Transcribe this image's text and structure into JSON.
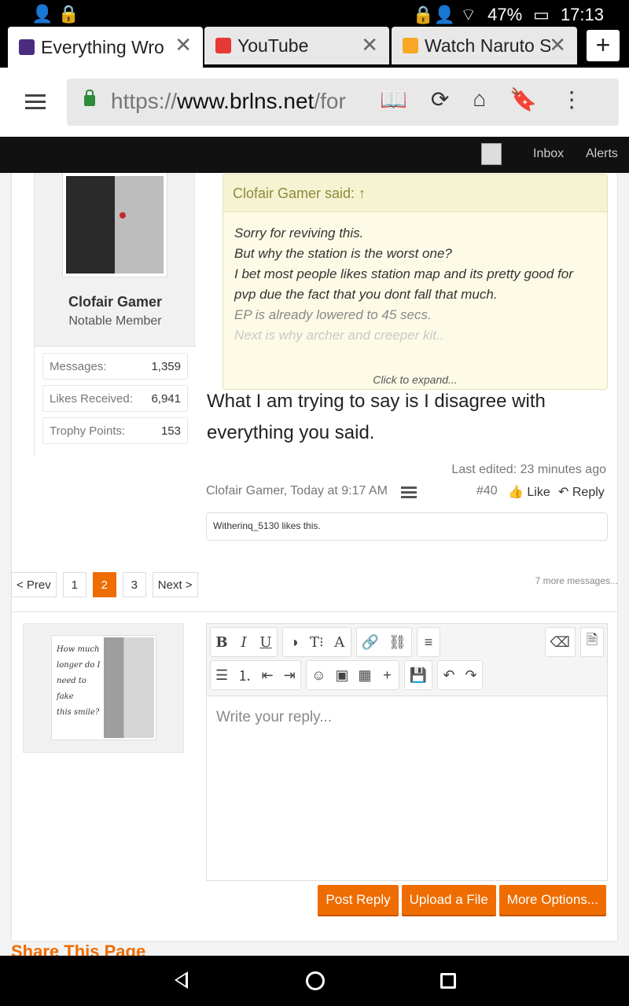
{
  "status": {
    "battery": "47%",
    "time": "17:13"
  },
  "tabs": [
    {
      "title": "Everything Wro",
      "favicon_color": "#4b2d7f"
    },
    {
      "title": "YouTube",
      "favicon_color": "#e53935"
    },
    {
      "title": "Watch Naruto S",
      "favicon_color": "#f9a825"
    }
  ],
  "url": {
    "scheme": "https://",
    "domain": "www.brlns.net",
    "path": "/for"
  },
  "site_nav": {
    "inbox": "Inbox",
    "alerts": "Alerts"
  },
  "post": {
    "username": "Clofair Gamer",
    "user_title": "Notable Member",
    "stats": [
      {
        "label": "Messages:",
        "value": "1,359"
      },
      {
        "label": "Likes Received:",
        "value": "6,941"
      },
      {
        "label": "Trophy Points:",
        "value": "153"
      }
    ],
    "quote_header": "Clofair Gamer said: ↑",
    "quote_lines": [
      "Sorry for reviving this.",
      "But why the station is the worst one?",
      "I bet most people likes station map and its pretty good for pvp due the fact that you dont fall that much.",
      "EP is already lowered to 45 secs.",
      "Next is why archer and creeper kit.."
    ],
    "quote_expand": "Click to expand...",
    "message": "What I am trying to say is I disagree with everything you said.",
    "last_edited": "Last edited: 23 minutes ago",
    "author_time": "Clofair Gamer, Today at 9:17 AM",
    "post_number": "#40",
    "like": "Like",
    "reply": "Reply",
    "likes_text": "Witherinq_5130 likes this."
  },
  "pager": {
    "prev": "< Prev",
    "pages": [
      "1",
      "2",
      "3"
    ],
    "current": "2",
    "next": "Next >",
    "more": "7 more messages..."
  },
  "reply_box": {
    "avatar_text": [
      "How much",
      "longer do I",
      "need to",
      "fake",
      "this smile?"
    ],
    "placeholder": "Write your reply...",
    "post_reply": "Post Reply",
    "upload": "Upload a File",
    "more_options": "More Options..."
  },
  "share_heading": "Share This Page"
}
